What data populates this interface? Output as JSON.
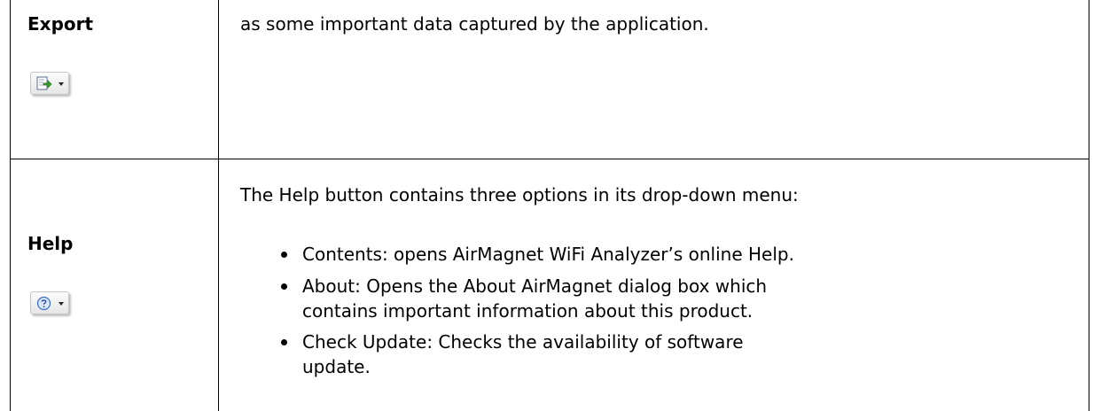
{
  "rows": [
    {
      "name": "Export",
      "icon": "export-icon",
      "description": "as some important data captured by the application."
    },
    {
      "name": "Help",
      "icon": "help-icon",
      "intro": "The Help button contains three options in its drop-down menu:",
      "options": [
        {
          "lines": [
            "Contents: opens AirMagnet WiFi Analyzer’s online Help."
          ]
        },
        {
          "lines": [
            "About: Opens the About AirMagnet dialog box which",
            "contains important information about this product."
          ]
        },
        {
          "lines": [
            "Check Update: Checks the availability of software",
            "update."
          ]
        }
      ]
    }
  ]
}
